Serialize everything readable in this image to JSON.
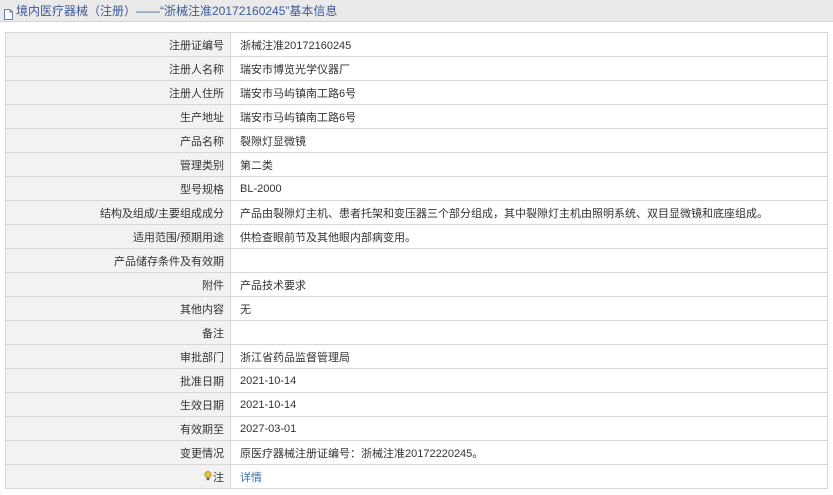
{
  "header": {
    "title": "境内医疗器械（注册）——“浙械注准20172160245”基本信息"
  },
  "rows": [
    {
      "label": "注册证编号",
      "value": "浙械注准20172160245"
    },
    {
      "label": "注册人名称",
      "value": "瑞安市博览光学仪器厂"
    },
    {
      "label": "注册人住所",
      "value": "瑞安市马屿镇南工路6号"
    },
    {
      "label": "生产地址",
      "value": "瑞安市马屿镇南工路6号"
    },
    {
      "label": "产品名称",
      "value": "裂隙灯显微镜"
    },
    {
      "label": "管理类别",
      "value": "第二类"
    },
    {
      "label": "型号规格",
      "value": "BL-2000"
    },
    {
      "label": "结构及组成/主要组成成分",
      "value": "产品由裂隙灯主机、患者托架和变压器三个部分组成，其中裂隙灯主机由照明系统、双目显微镜和底座组成。"
    },
    {
      "label": "适用范围/预期用途",
      "value": "供检查眼前节及其他眼内部病变用。"
    },
    {
      "label": "产品储存条件及有效期",
      "value": ""
    },
    {
      "label": "附件",
      "value": "产品技术要求"
    },
    {
      "label": "其他内容",
      "value": "无"
    },
    {
      "label": "备注",
      "value": ""
    },
    {
      "label": "审批部门",
      "value": "浙江省药品监督管理局"
    },
    {
      "label": "批准日期",
      "value": "2021-10-14"
    },
    {
      "label": "生效日期",
      "value": "2021-10-14"
    },
    {
      "label": "有效期至",
      "value": "2027-03-01"
    },
    {
      "label": "变更情况",
      "value": "原医疗器械注册证编号：浙械注准20172220245。"
    }
  ],
  "note": {
    "icon": "bulb-icon",
    "label": "注",
    "link_text": "详情"
  }
}
